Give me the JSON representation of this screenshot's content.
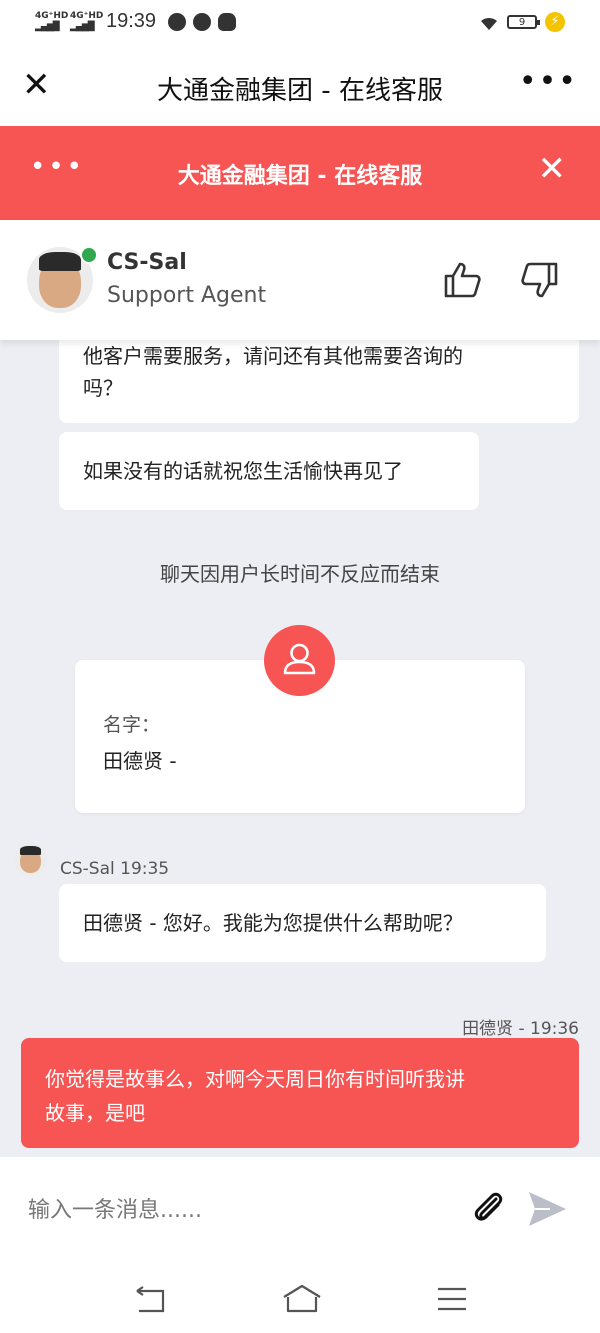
{
  "status_bar": {
    "network_1": "4G⁺HD",
    "network_2": "4G⁺HD",
    "time": "19:39",
    "battery": "9",
    "charging_icon": "lightning-icon"
  },
  "app_bar": {
    "title": "大通金融集团 - 在线客服",
    "close_icon": "close-icon",
    "more_icon": "more-icon"
  },
  "chat_header": {
    "title": "大通金融集团 - 在线客服",
    "more_icon": "more-icon",
    "close_icon": "close-icon",
    "color": "#f75454"
  },
  "agent": {
    "name": "CS-Sal",
    "role": "Support Agent",
    "online_color": "#2fa84f"
  },
  "messages": {
    "agent_msg_1": [
      "他客户需要服务，请问还有其他需要咨询的",
      "吗？"
    ],
    "agent_msg_2": "如果没有的话就祝您生活愉快再见了",
    "system_msg": "聊天因用户长时间不反应而结束",
    "form_label": "名字：",
    "form_value": "田德贤 -",
    "agent_meta": "CS-Sal 19:35",
    "agent_msg_3": "田德贤 - 您好。我能为您提供什么帮助呢？",
    "user_meta": "田德贤 - 19:36",
    "user_msg": [
      "你觉得是故事么，对啊今天周日你有时间听我讲",
      "故事，是吧"
    ]
  },
  "input_bar": {
    "placeholder": "输入一条消息......",
    "attach_icon": "paperclip-icon",
    "send_icon": "send-icon"
  },
  "nav_bar": {
    "back_icon": "back-icon",
    "home_icon": "home-icon",
    "menu_icon": "menu-icon"
  }
}
